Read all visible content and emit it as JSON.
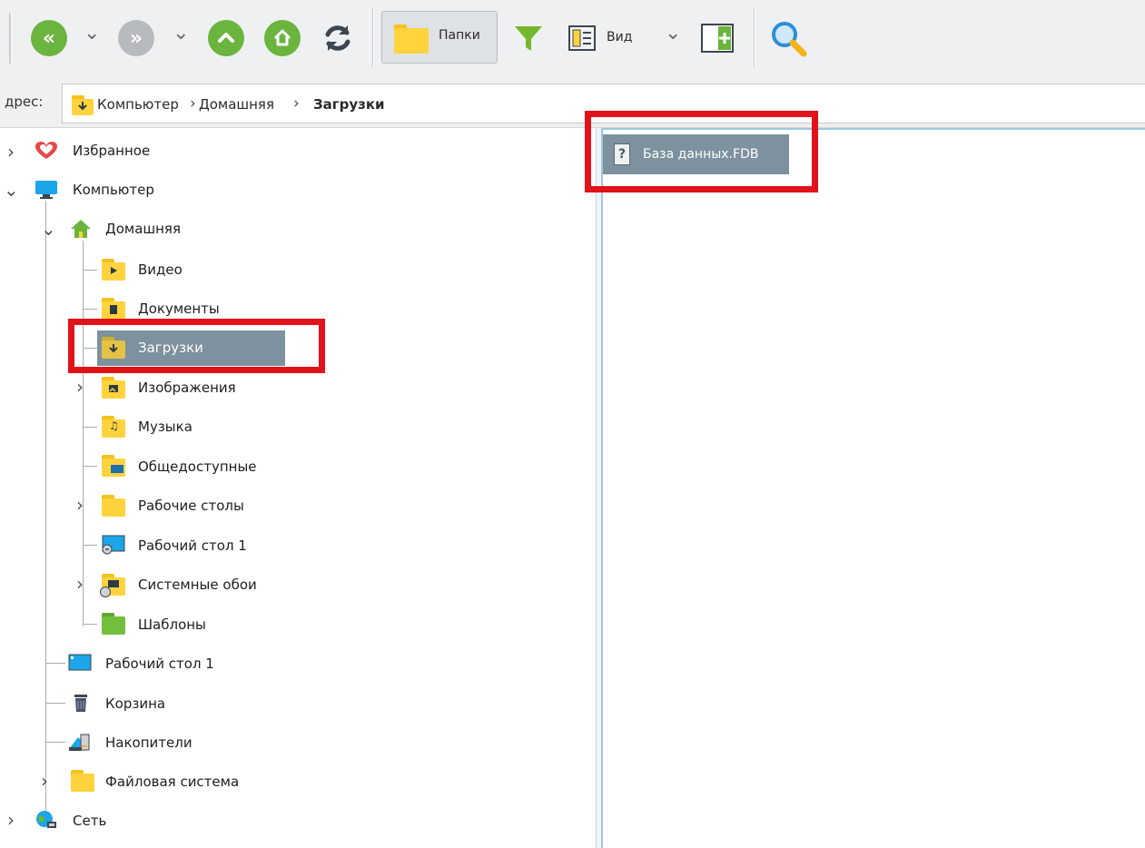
{
  "toolbar": {
    "back_icon": "double-chevron-left-icon",
    "forward_icon": "double-chevron-right-icon",
    "up_icon": "chevron-up-icon",
    "home_icon": "home-icon",
    "refresh_icon": "refresh-icon",
    "folders_label": "Папки",
    "filter_icon": "filter-icon",
    "view_label": "Вид",
    "new_panel_icon": "add-panel-icon",
    "search_icon": "search-icon",
    "colors": {
      "green": "#6bb43e",
      "gray": "#b8bbbd",
      "filter": "#74b72e"
    }
  },
  "address": {
    "label": "дрес:",
    "crumbs": [
      "Компьютер",
      "Домашняя",
      "Загрузки"
    ]
  },
  "tree": {
    "favorites": "Избранное",
    "computer": "Компьютер",
    "home": "Домашняя",
    "home_children": [
      "Видео",
      "Документы",
      "Загрузки",
      "Изображения",
      "Музыка",
      "Общедоступные",
      "Рабочие столы",
      "Рабочий стол 1",
      "Системные обои",
      "Шаблоны"
    ],
    "computer_children": [
      "Рабочий стол 1",
      "Корзина",
      "Накопители",
      "Файловая система"
    ],
    "network": "Сеть",
    "selected": "Загрузки"
  },
  "content": {
    "files": [
      {
        "name": "База данных.FDB",
        "icon": "unknown-file-icon"
      }
    ]
  },
  "highlight_color": "#e1121a",
  "selection_color": "#7d919e"
}
